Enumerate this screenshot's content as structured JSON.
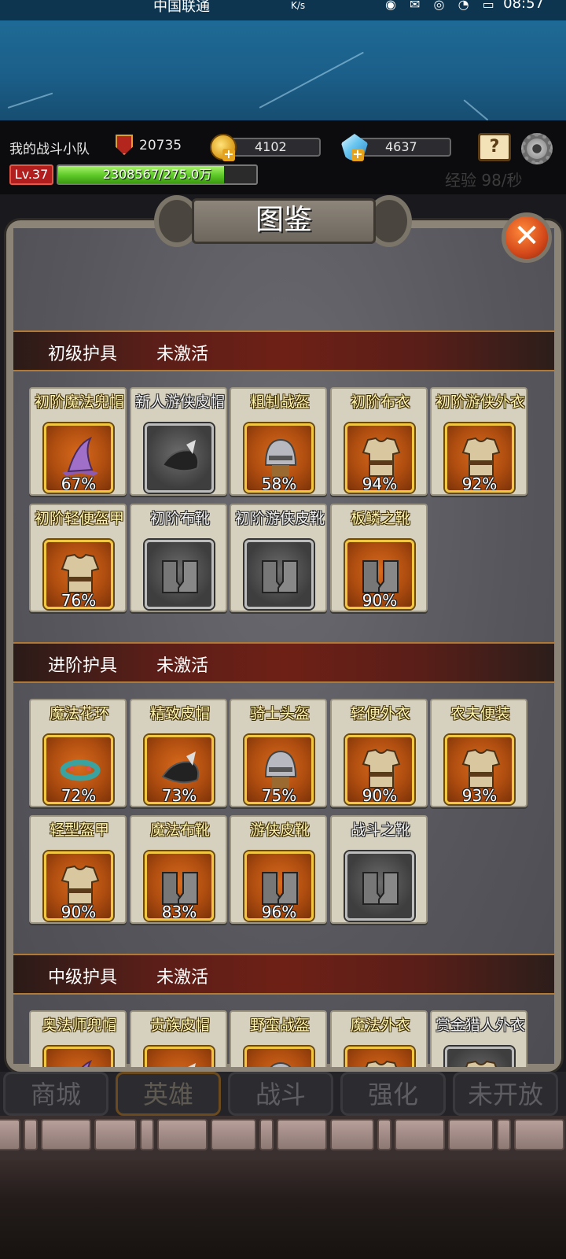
{
  "status": {
    "carrier": "中国联通",
    "speed": "K/s",
    "time": "08:57"
  },
  "hud": {
    "team_name": "我的战斗小队",
    "power": "20735",
    "gold": "4102",
    "gems": "4637",
    "level": "Lv.37",
    "exp_text": "2308567/275.0万",
    "exp_fraction": 0.839,
    "exp_rate": "经验 98/秒"
  },
  "panel": {
    "title": "图鉴",
    "close_symbol": "✕"
  },
  "sections": [
    {
      "name": "初级护具",
      "status": "未激活",
      "items": [
        {
          "label": "初阶魔法兜帽",
          "percent": "67%",
          "locked": false,
          "icon": "wizard-hat-icon"
        },
        {
          "label": "新人游侠皮帽",
          "percent": "",
          "locked": true,
          "icon": "ranger-cap-icon"
        },
        {
          "label": "粗制战盔",
          "percent": "58%",
          "locked": false,
          "icon": "helmet-icon"
        },
        {
          "label": "初阶布衣",
          "percent": "94%",
          "locked": false,
          "icon": "cloth-armor-icon"
        },
        {
          "label": "初阶游侠外衣",
          "percent": "92%",
          "locked": false,
          "icon": "ranger-coat-icon"
        },
        {
          "label": "初阶轻便盔甲",
          "percent": "76%",
          "locked": false,
          "icon": "light-armor-icon"
        },
        {
          "label": "初阶布靴",
          "percent": "",
          "locked": true,
          "icon": "cloth-boots-icon"
        },
        {
          "label": "初阶游侠皮靴",
          "percent": "",
          "locked": true,
          "icon": "ranger-boots-icon"
        },
        {
          "label": "板鳞之靴",
          "percent": "90%",
          "locked": false,
          "icon": "scale-boots-icon"
        }
      ]
    },
    {
      "name": "进阶护具",
      "status": "未激活",
      "items": [
        {
          "label": "魔法花环",
          "percent": "72%",
          "locked": false,
          "icon": "magic-wreath-icon"
        },
        {
          "label": "精致皮帽",
          "percent": "73%",
          "locked": false,
          "icon": "goggle-cap-icon"
        },
        {
          "label": "骑士头盔",
          "percent": "75%",
          "locked": false,
          "icon": "knight-helmet-icon"
        },
        {
          "label": "轻便外衣",
          "percent": "90%",
          "locked": false,
          "icon": "green-coat-icon"
        },
        {
          "label": "农夫便装",
          "percent": "93%",
          "locked": false,
          "icon": "farmer-shirt-icon"
        },
        {
          "label": "轻型盔甲",
          "percent": "90%",
          "locked": false,
          "icon": "plate-armor-icon"
        },
        {
          "label": "魔法布靴",
          "percent": "83%",
          "locked": false,
          "icon": "magic-boots-icon"
        },
        {
          "label": "游侠皮靴",
          "percent": "96%",
          "locked": false,
          "icon": "leather-boots-icon"
        },
        {
          "label": "战斗之靴",
          "percent": "",
          "locked": true,
          "icon": "battle-boots-icon"
        }
      ]
    },
    {
      "name": "中级护具",
      "status": "未激活",
      "items": [
        {
          "label": "奥法师兜帽",
          "percent": "",
          "locked": false,
          "icon": "arcane-hood-icon"
        },
        {
          "label": "贵族皮帽",
          "percent": "",
          "locked": false,
          "icon": "noble-cap-icon"
        },
        {
          "label": "野蛮战盔",
          "percent": "",
          "locked": false,
          "icon": "barbarian-helmet-icon"
        },
        {
          "label": "魔法外衣",
          "percent": "",
          "locked": false,
          "icon": "magic-coat-icon"
        },
        {
          "label": "赏金猎人外衣",
          "percent": "",
          "locked": true,
          "icon": "bounty-coat-icon"
        }
      ]
    }
  ],
  "nav": [
    {
      "label": "商城"
    },
    {
      "label": "英雄"
    },
    {
      "label": "战斗"
    },
    {
      "label": "强化"
    },
    {
      "label": "未开放"
    }
  ]
}
